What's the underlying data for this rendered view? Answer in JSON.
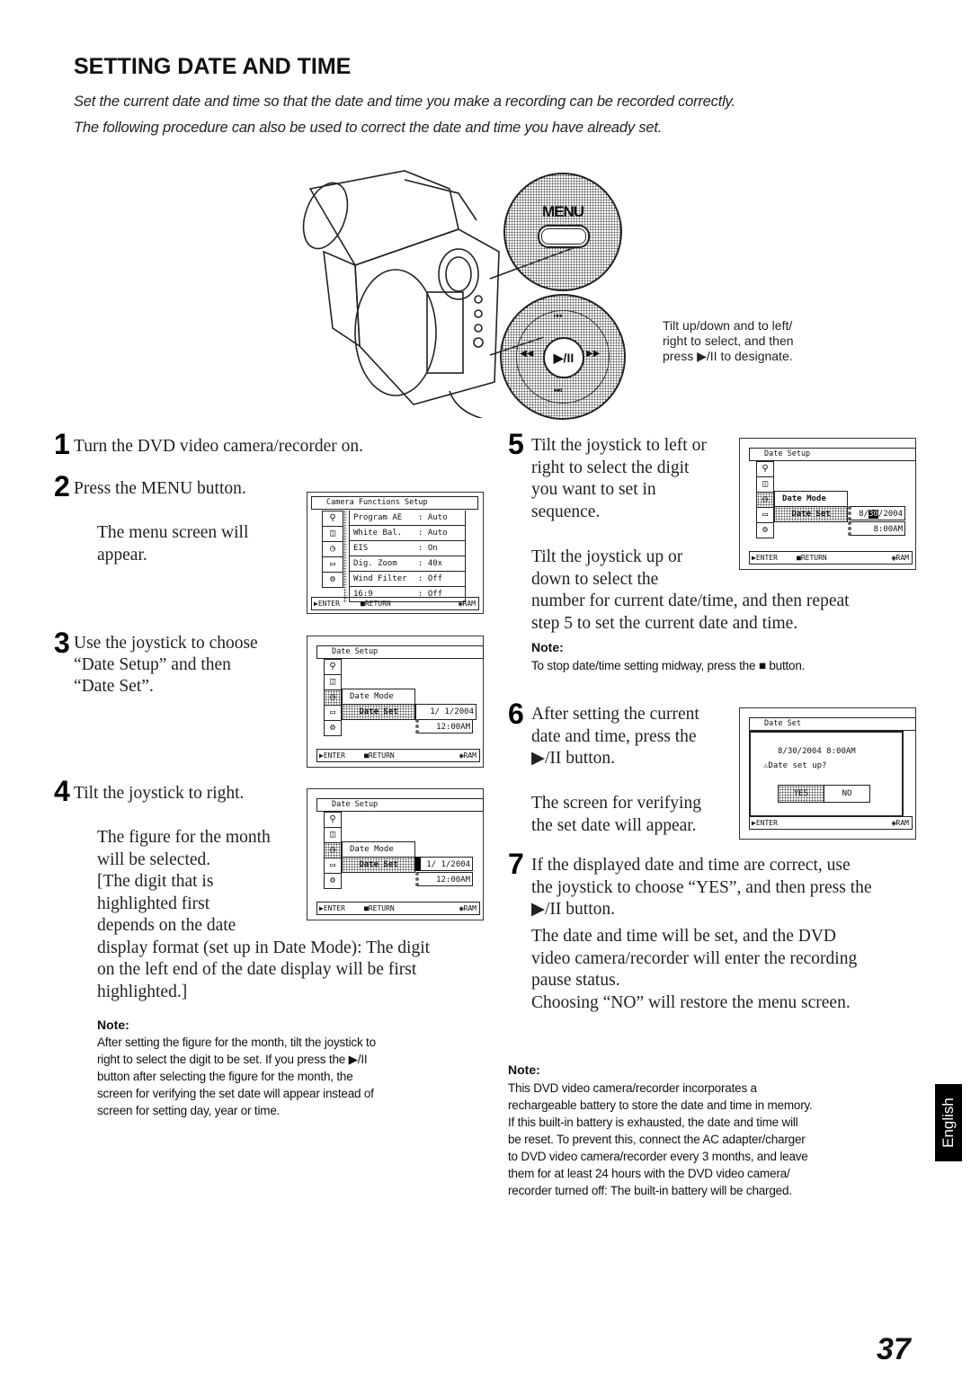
{
  "page": {
    "heading": "SETTING DATE AND TIME",
    "intro_line1": "Set the current date and time so that the date and time you make a recording can be recorded correctly.",
    "intro_line2": "The following procedure can also be used to correct the date and time you have already set.",
    "page_number": "37",
    "language_tab": "English"
  },
  "illustration": {
    "menu_button_label": "MENU",
    "joystick_center": "▶/II",
    "joystick_up": "◀◀ ",
    "caption_line1": "Tilt up/down and to left/",
    "caption_line2": "right to select, and then",
    "caption_line3": "press ▶/II to designate."
  },
  "steps": [
    {
      "num": "1",
      "text": "Turn the DVD video camera/recorder on."
    },
    {
      "num": "2",
      "text": "Press the MENU button.",
      "sub": [
        "The menu screen will",
        "appear."
      ]
    },
    {
      "num": "3",
      "lines": [
        "Use the joystick to choose",
        "“Date Setup” and then",
        "“Date Set”."
      ]
    },
    {
      "num": "4",
      "text": "Tilt the joystick to right.",
      "lines": [
        "The figure for the month",
        "will be selected.",
        "[The digit that is",
        "highlighted first",
        "depends on the date",
        "display format (set up in Date Mode): The digit",
        "on the left end of the date display will be first",
        "highlighted.]"
      ],
      "note_title": "Note:",
      "note_lines": [
        "After setting the figure for the month, tilt the joystick to",
        "right to select the digit to be set. If you press the ▶/II",
        "button after selecting the figure for the month, the",
        "screen for verifying the set date will appear instead of",
        "screen for setting day, year or time."
      ]
    },
    {
      "num": "5",
      "lines": [
        "Tilt the joystick to left or",
        "right to select the digit",
        "you want to set in",
        "sequence."
      ],
      "lines2": [
        "Tilt the joystick up or",
        "down to select the",
        "number for current date/time, and then repeat",
        "step 5 to set the current date and time."
      ],
      "note_title": "Note:",
      "note_text": "To stop date/time setting midway, press the ■ button."
    },
    {
      "num": "6",
      "lines": [
        "After setting the current",
        "date and time, press the",
        "▶/II button."
      ],
      "lines2": [
        "The screen for verifying",
        "the set date will appear."
      ]
    },
    {
      "num": "7",
      "lines": [
        "If the displayed date and time are correct, use",
        "the joystick to choose “YES”, and then press the",
        "▶/II button."
      ],
      "lines2": [
        "The date and time will be set, and the DVD",
        "video camera/recorder will enter the recording",
        "pause status.",
        "Choosing “NO” will restore the menu screen."
      ]
    }
  ],
  "final_note": {
    "title": "Note:",
    "lines": [
      "This DVD video camera/recorder incorporates a",
      "rechargeable battery to store the date and time in memory.",
      "If this built-in battery is exhausted, the date and time will",
      "be reset. To prevent this, connect the AC adapter/charger",
      "to DVD video camera/recorder every 3 months, and leave",
      "them for at least 24 hours with the DVD video camera/",
      "recorder turned off: The built-in battery will be charged."
    ]
  },
  "screens": {
    "menu": {
      "title": "Camera Functions Setup",
      "rows": [
        {
          "label": "Program AE",
          "value": ": Auto"
        },
        {
          "label": "White Bal.",
          "value": ": Auto"
        },
        {
          "label": "EIS",
          "value": ": On"
        },
        {
          "label": "Dig. Zoom",
          "value": ": 40x"
        },
        {
          "label": "Wind Filter",
          "value": ": Off"
        },
        {
          "label": "16:9",
          "value": ": Off"
        }
      ],
      "footer_enter": "▶ENTER",
      "footer_return": "■RETURN",
      "footer_mode": "◉RAM"
    },
    "date_setup": {
      "title": "Date Setup",
      "item1": "Date Mode",
      "item2": "Date Set",
      "date_initial": "1/ 1/2004",
      "time_initial": "12:00AM",
      "date_step5_pre": "8/",
      "date_step5_hl": "30",
      "date_step5_post": "/2004",
      "time_step5": "8:00AM",
      "footer_enter": "▶ENTER",
      "footer_return": "■RETURN",
      "footer_mode": "◉RAM"
    },
    "verify": {
      "title": "Date Set",
      "datetime": "8/30/2004  8:00AM",
      "question": "Date set up?",
      "yes": "YES",
      "no": "NO",
      "footer_enter": "▶ENTER",
      "footer_mode": "◉RAM"
    }
  }
}
